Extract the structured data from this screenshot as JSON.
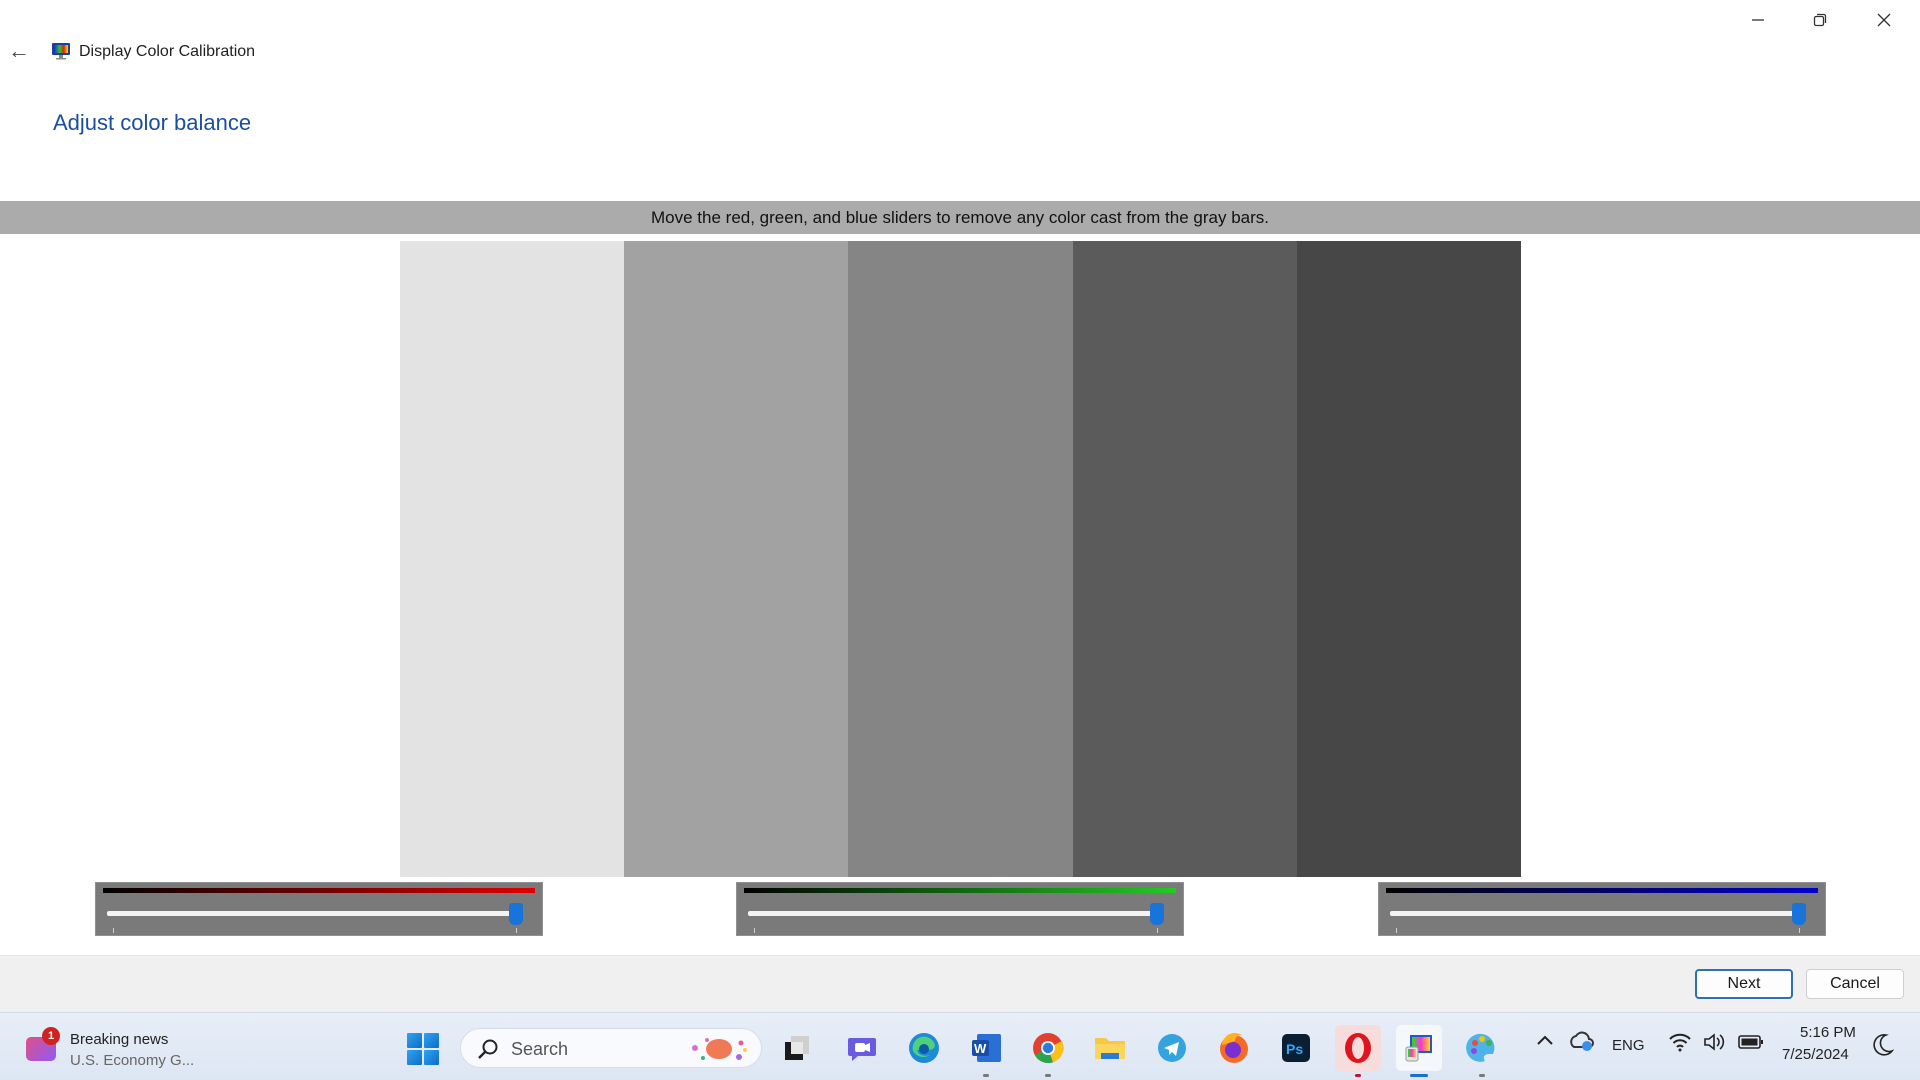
{
  "window": {
    "title": "Display Color Calibration",
    "controls": {
      "minimize": "minimize",
      "maximize": "restore",
      "close": "close"
    }
  },
  "page": {
    "heading": "Adjust color balance",
    "instruction": "Move the red, green, and blue sliders to remove any color cast from the gray bars."
  },
  "gray_bars": {
    "colors": [
      "#e3e3e3",
      "#a2a2a2",
      "#858585",
      "#5b5b5b",
      "#474747"
    ]
  },
  "sliders": [
    {
      "name": "red",
      "color": "#e00000",
      "value_percent": 100
    },
    {
      "name": "green",
      "color": "#22cc22",
      "value_percent": 100
    },
    {
      "name": "blue",
      "color": "#0000d0",
      "value_percent": 100
    }
  ],
  "footer": {
    "next_label": "Next",
    "cancel_label": "Cancel"
  },
  "taskbar": {
    "news": {
      "badge": "1",
      "title": "Breaking news",
      "subtitle": "U.S. Economy G..."
    },
    "search_placeholder": "Search",
    "apps": [
      {
        "name": "task-view"
      },
      {
        "name": "teams-chat"
      },
      {
        "name": "edge"
      },
      {
        "name": "word",
        "running": true
      },
      {
        "name": "chrome",
        "running": true
      },
      {
        "name": "file-explorer"
      },
      {
        "name": "telegram"
      },
      {
        "name": "firefox"
      },
      {
        "name": "photoshop"
      },
      {
        "name": "opera",
        "running": true
      },
      {
        "name": "display-color-calibration",
        "running": true,
        "active": true
      },
      {
        "name": "paint",
        "running": true
      }
    ],
    "tray": {
      "language": "ENG",
      "time": "5:16 PM",
      "date": "7/25/2024"
    }
  }
}
